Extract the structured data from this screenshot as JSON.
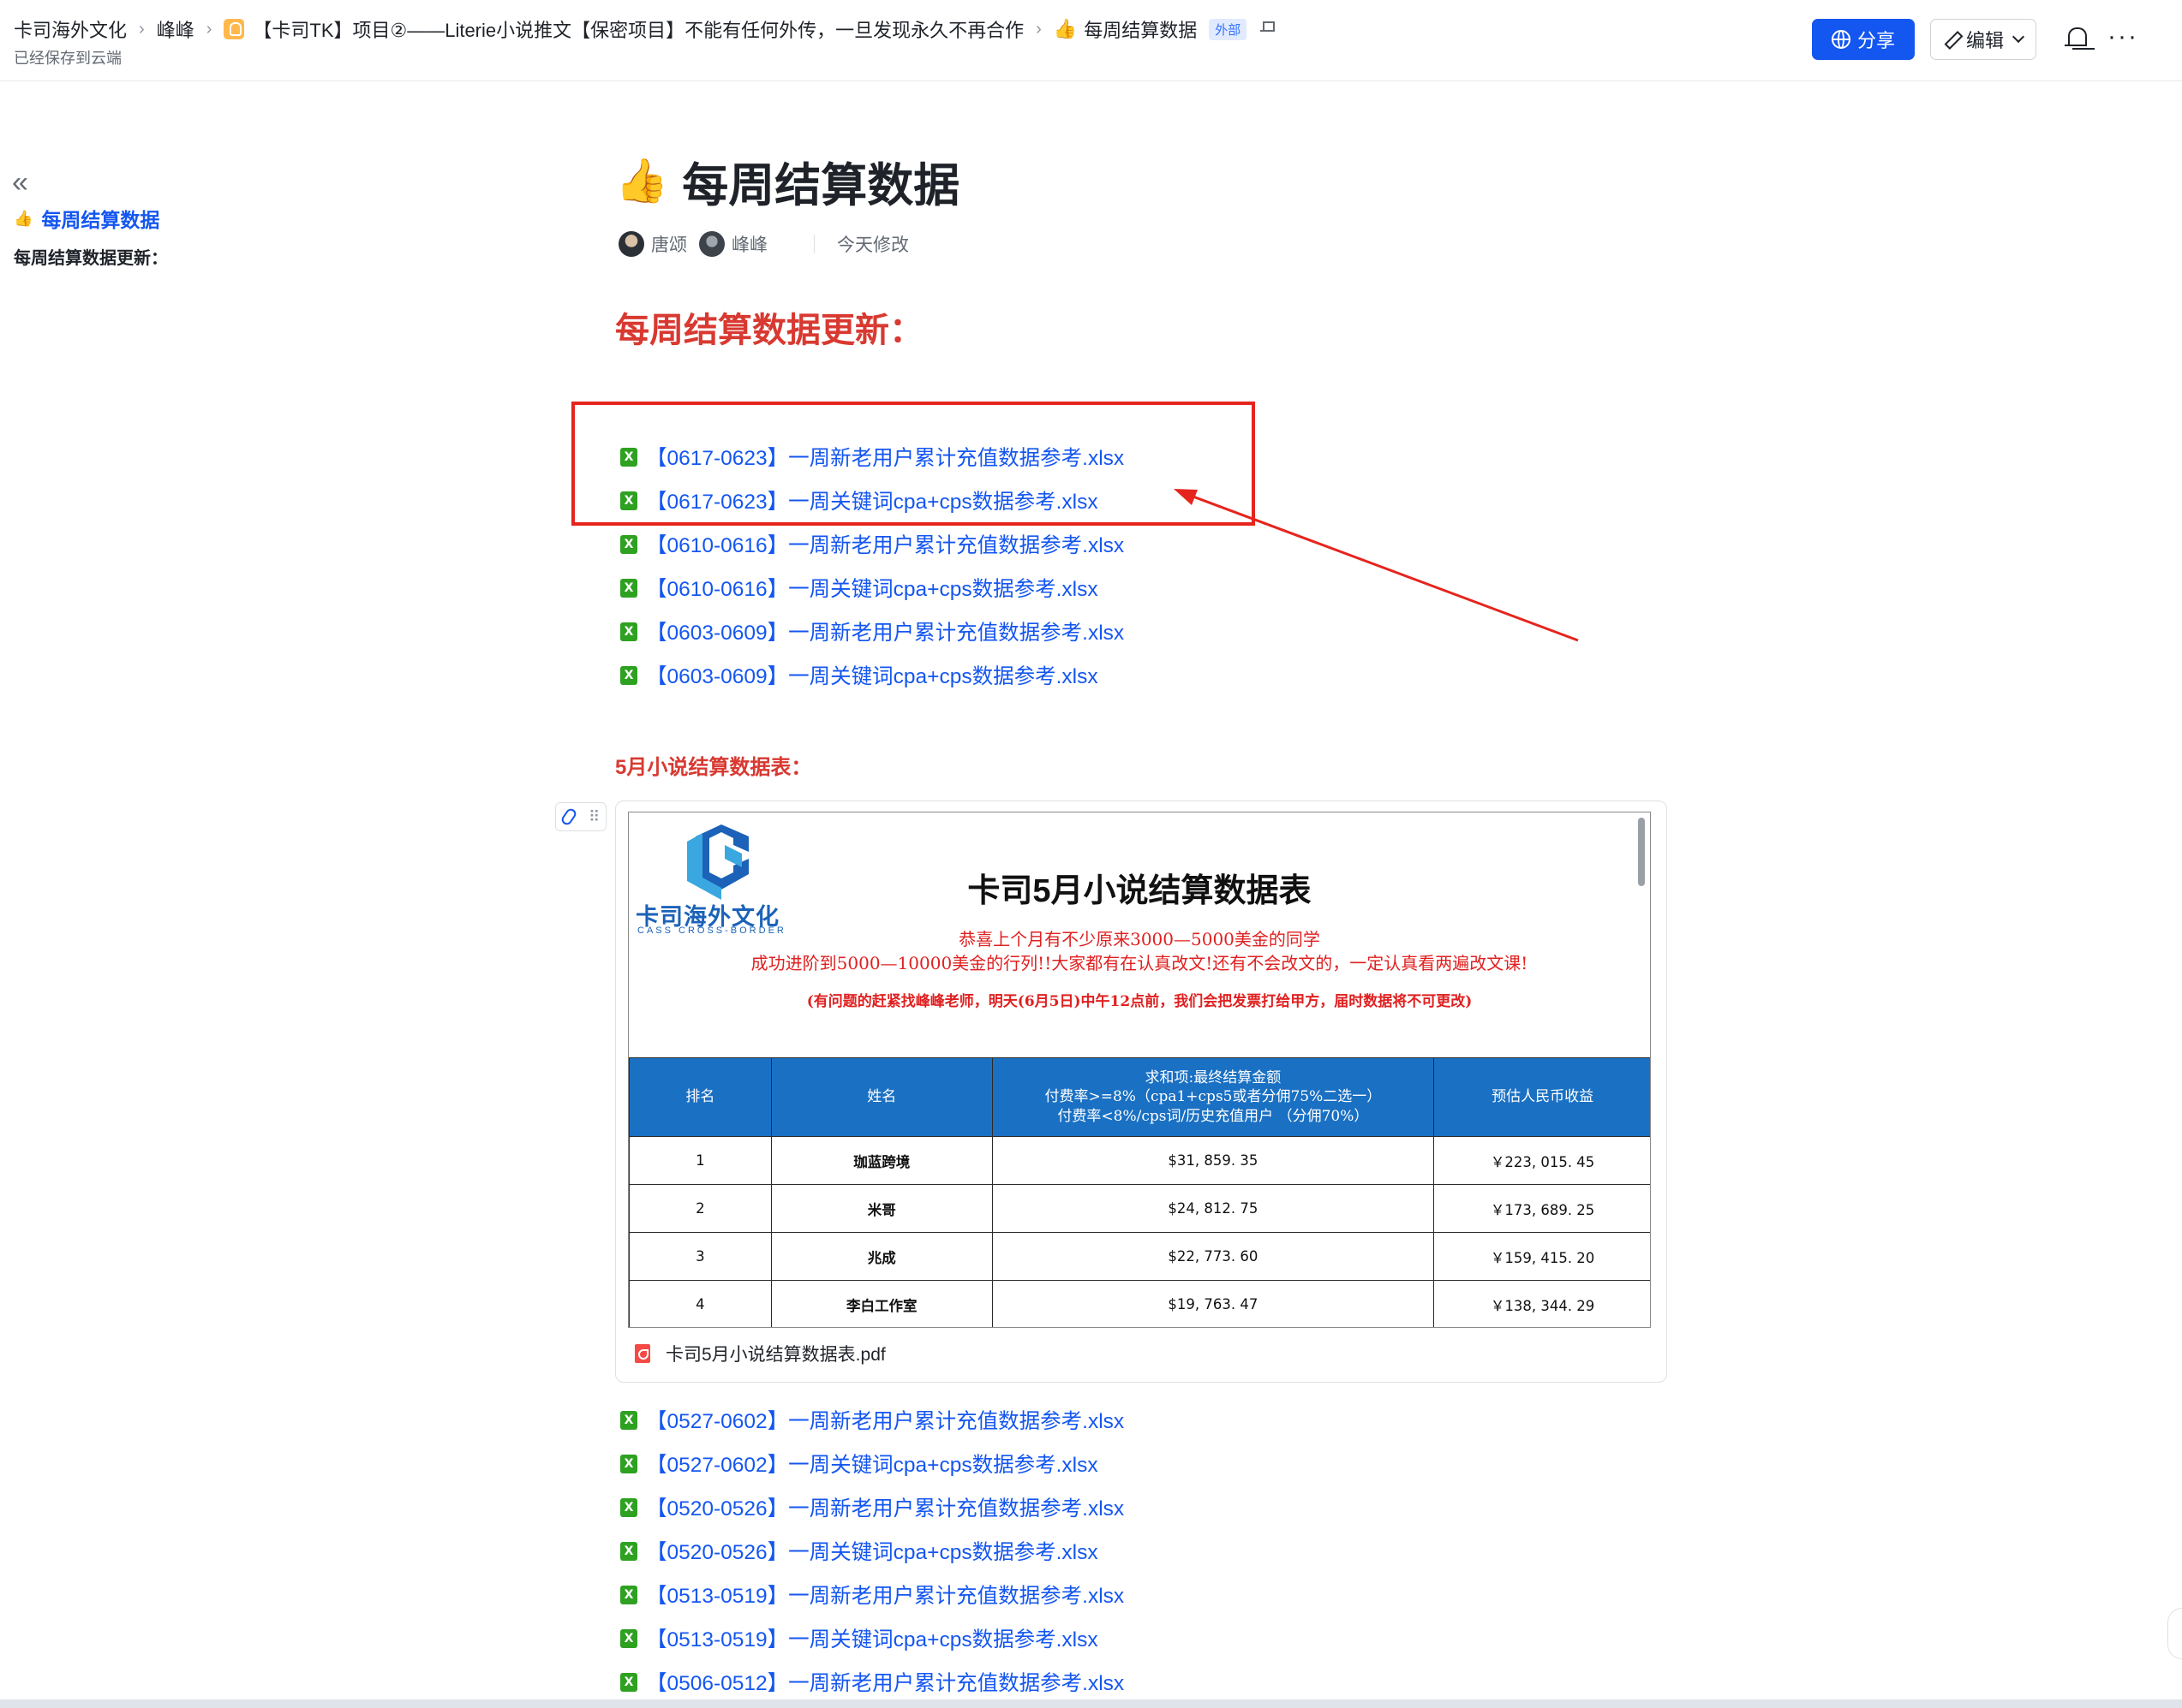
{
  "breadcrumb": {
    "items": [
      "卡司海外文化",
      "峰峰",
      "【卡司TK】项目②——Literie小说推文【保密项目】不能有任何外传，一旦发现永久不再合作",
      "每周结算数据"
    ],
    "badge": "外部"
  },
  "status": {
    "saved": "已经保存到云端"
  },
  "toolbar": {
    "share_label": "分享",
    "edit_label": "编辑",
    "more_label": "···"
  },
  "outline": {
    "title": "每周结算数据",
    "items": [
      "每周结算数据更新："
    ]
  },
  "doc": {
    "title": "每周结算数据",
    "authors": [
      "唐颂",
      "峰峰"
    ],
    "modified": "今天修改",
    "heading": "每周结算数据更新：",
    "files_top": [
      "【0617-0623】一周新老用户累计充值数据参考.xlsx",
      "【0617-0623】一周关键词cpa+cps数据参考.xlsx",
      "【0610-0616】一周新老用户累计充值数据参考.xlsx",
      "【0610-0616】一周关键词cpa+cps数据参考.xlsx",
      "【0603-0609】一周新老用户累计充值数据参考.xlsx",
      "【0603-0609】一周关键词cpa+cps数据参考.xlsx"
    ],
    "may_heading": "5月小说结算数据表：",
    "files_bottom": [
      "【0527-0602】一周新老用户累计充值数据参考.xlsx",
      "【0527-0602】一周关键词cpa+cps数据参考.xlsx",
      "【0520-0526】一周新老用户累计充值数据参考.xlsx",
      "【0520-0526】一周关键词cpa+cps数据参考.xlsx",
      "【0513-0519】一周新老用户累计充值数据参考.xlsx",
      "【0513-0519】一周关键词cpa+cps数据参考.xlsx",
      "【0506-0512】一周新老用户累计充值数据参考.xlsx"
    ],
    "file_icon_glyph": "X"
  },
  "attachment": {
    "file_name": "卡司5月小说结算数据表.pdf",
    "logo_text": "卡司海外文化",
    "logo_sub": "CASS CROSS-BORDER",
    "pdf_title": "卡司5月小说结算数据表",
    "line1": "恭喜上个月有不少原来3000—5000美金的同学",
    "line2": "成功进阶到5000—10000美金的行列!!大家都有在认真改文!还有不会改文的，一定认真看两遍改文课!",
    "line3": "(有问题的赶紧找峰峰老师，明天(6月5日)中午12点前，我们会把发票打给甲方，届时数据将不可更改)",
    "table": {
      "headers": {
        "rank": "排名",
        "name": "姓名",
        "sum_l1": "求和项:最终结算金额",
        "sum_l2": "付费率>=8%（cpa1+cps5或者分佣75%二选一）",
        "sum_l3": "付费率<8%/cps词/历史充值用户  （分佣70%）",
        "rmb": "预估人民币收益"
      },
      "rows": [
        {
          "rank": "1",
          "name": "珈蓝跨境",
          "usd": "$31, 859. 35",
          "rmb": "￥223, 015. 45"
        },
        {
          "rank": "2",
          "name": "米哥",
          "usd": "$24, 812. 75",
          "rmb": "￥173, 689. 25"
        },
        {
          "rank": "3",
          "name": "兆成",
          "usd": "$22, 773. 60",
          "rmb": "￥159, 415. 20"
        },
        {
          "rank": "4",
          "name": "李白工作室",
          "usd": "$19, 763. 47",
          "rmb": "￥138, 344. 29"
        }
      ]
    }
  },
  "colors": {
    "accent": "#1456f0",
    "heading_red": "#d83931",
    "annotation_red": "#e5251d",
    "xlsx_green": "#2ea121",
    "table_header": "#1a70c3"
  }
}
